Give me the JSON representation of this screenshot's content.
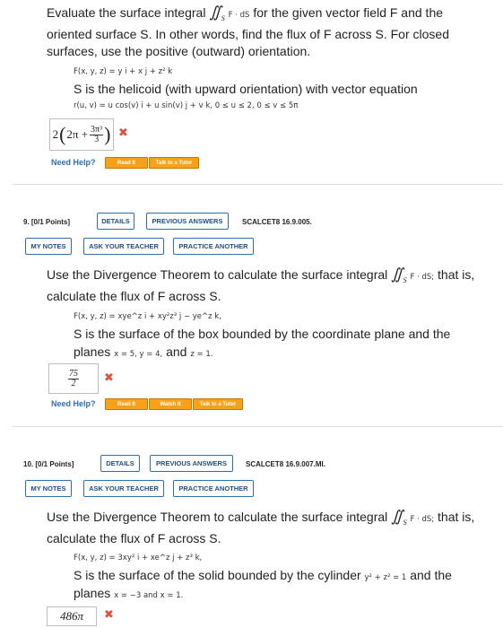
{
  "q8": {
    "line1_pre": "Evaluate the surface integral",
    "line1_integrand": "F · dS",
    "line1_post": "for the given vector field F and the",
    "line2": "oriented surface S. In other words, find the flux of F across S. For closed",
    "line3": "surfaces, use the positive (outward) orientation.",
    "field": "F(x, y, z) = y i + x j + z² k",
    "surface": "S is the helicoid (with upward orientation) with vector equation",
    "param": "r(u, v) = u cos(v) i + u sin(v) j + v k, 0 ≤ u ≤ 2, 0 ≤ v ≤ 5π",
    "answer_pre": "2",
    "answer_inner": "2π +",
    "answer_num": "3π³",
    "answer_den": "3",
    "need_help": "Need Help?",
    "read_it": "Read It",
    "talk_tutor": "Talk to a Tutor"
  },
  "q9": {
    "heading": "9. [0/1 Points]",
    "details": "DETAILS",
    "previous": "PREVIOUS ANSWERS",
    "code": "SCALCET8 16.9.005.",
    "my_notes": "MY NOTES",
    "ask_teacher": "ASK YOUR TEACHER",
    "practice": "PRACTICE ANOTHER",
    "line1_pre": "Use the Divergence Theorem to calculate the surface integral",
    "line1_integrand": "F · dS;",
    "line1_post": "that is,",
    "line2": "calculate the flux of F across S.",
    "field": "F(x, y, z) = xye^z i + xy²z³ j − ye^z k,",
    "surface": "S is the surface of the box bounded by the coordinate plane and the",
    "planes_pre": "planes",
    "planes_math1": "x = 5, y = 4,",
    "planes_and": "and",
    "planes_math2": "z = 1.",
    "answer_num": "75",
    "answer_den": "2",
    "need_help": "Need Help?",
    "read_it": "Read It",
    "watch_it": "Watch It",
    "talk_tutor": "Talk to a Tutor"
  },
  "q10": {
    "heading": "10. [0/1 Points]",
    "details": "DETAILS",
    "previous": "PREVIOUS ANSWERS",
    "code": "SCALCET8 16.9.007.MI.",
    "my_notes": "MY NOTES",
    "ask_teacher": "ASK YOUR TEACHER",
    "practice": "PRACTICE ANOTHER",
    "line1_pre": "Use the Divergence Theorem to calculate the surface integral",
    "line1_integrand": "F · dS;",
    "line1_post": "that is,",
    "line2": "calculate the flux of F across S.",
    "field": "F(x, y, z) = 3xy² i + xe^z j + z³ k,",
    "surface_pre": "S is the surface of the solid bounded by the cylinder",
    "surface_math": "y² + z² = 1",
    "surface_post": "and the",
    "planes_pre": "planes",
    "planes_math": "x = −3 and x = 1.",
    "answer": "486π"
  },
  "colors": {
    "accent": "#2f6fb0",
    "wrong": "#e0513b",
    "help_button": "#f7a11b"
  }
}
